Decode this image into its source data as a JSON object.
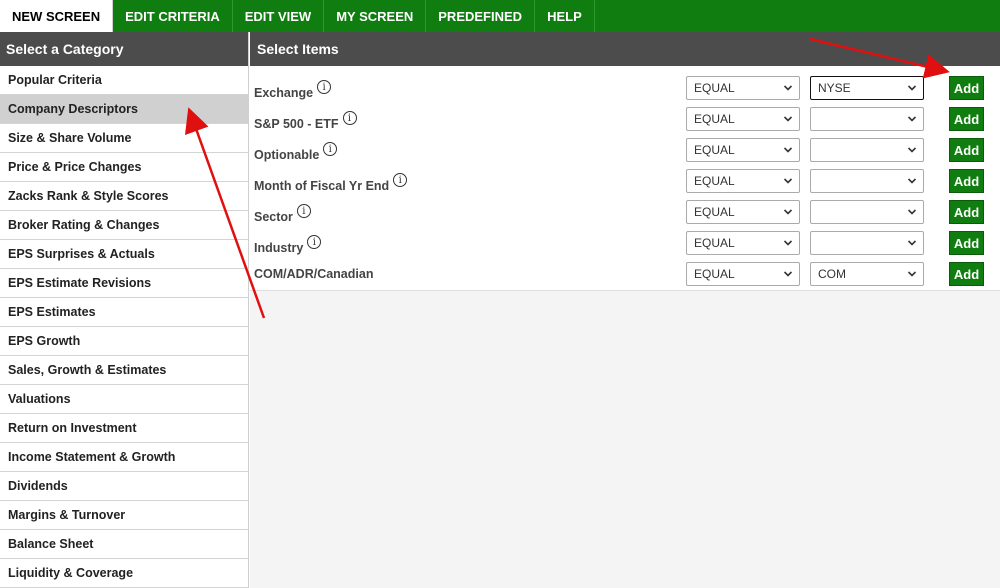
{
  "nav": {
    "tabs": [
      "NEW SCREEN",
      "EDIT CRITERIA",
      "EDIT VIEW",
      "MY SCREEN",
      "PREDEFINED",
      "HELP"
    ],
    "active_tab": "NEW SCREEN"
  },
  "sidebar": {
    "header": "Select a Category",
    "selected": "Company Descriptors",
    "items": [
      "Popular Criteria",
      "Company Descriptors",
      "Size & Share Volume",
      "Price & Price Changes",
      "Zacks Rank & Style Scores",
      "Broker Rating & Changes",
      "EPS Surprises & Actuals",
      "EPS Estimate Revisions",
      "EPS Estimates",
      "EPS Growth",
      "Sales, Growth & Estimates",
      "Valuations",
      "Return on Investment",
      "Income Statement & Growth",
      "Dividends",
      "Margins & Turnover",
      "Balance Sheet",
      "Liquidity & Coverage"
    ]
  },
  "main": {
    "header": "Select Items",
    "add_label": "Add",
    "info_glyph": "i",
    "rows": [
      {
        "label": "Exchange",
        "info": true,
        "operator": "EQUAL",
        "value": "NYSE"
      },
      {
        "label": "S&P 500 - ETF",
        "info": true,
        "operator": "EQUAL",
        "value": ""
      },
      {
        "label": "Optionable",
        "info": true,
        "operator": "EQUAL",
        "value": ""
      },
      {
        "label": "Month of Fiscal Yr End",
        "info": true,
        "operator": "EQUAL",
        "value": ""
      },
      {
        "label": "Sector",
        "info": true,
        "operator": "EQUAL",
        "value": ""
      },
      {
        "label": "Industry",
        "info": true,
        "operator": "EQUAL",
        "value": ""
      },
      {
        "label": "COM/ADR/Canadian",
        "info": false,
        "operator": "EQUAL",
        "value": "COM"
      }
    ]
  },
  "colors": {
    "nav_green": "#107d10",
    "header_gray": "#4c4c4c",
    "annotation_red": "#e01010"
  }
}
